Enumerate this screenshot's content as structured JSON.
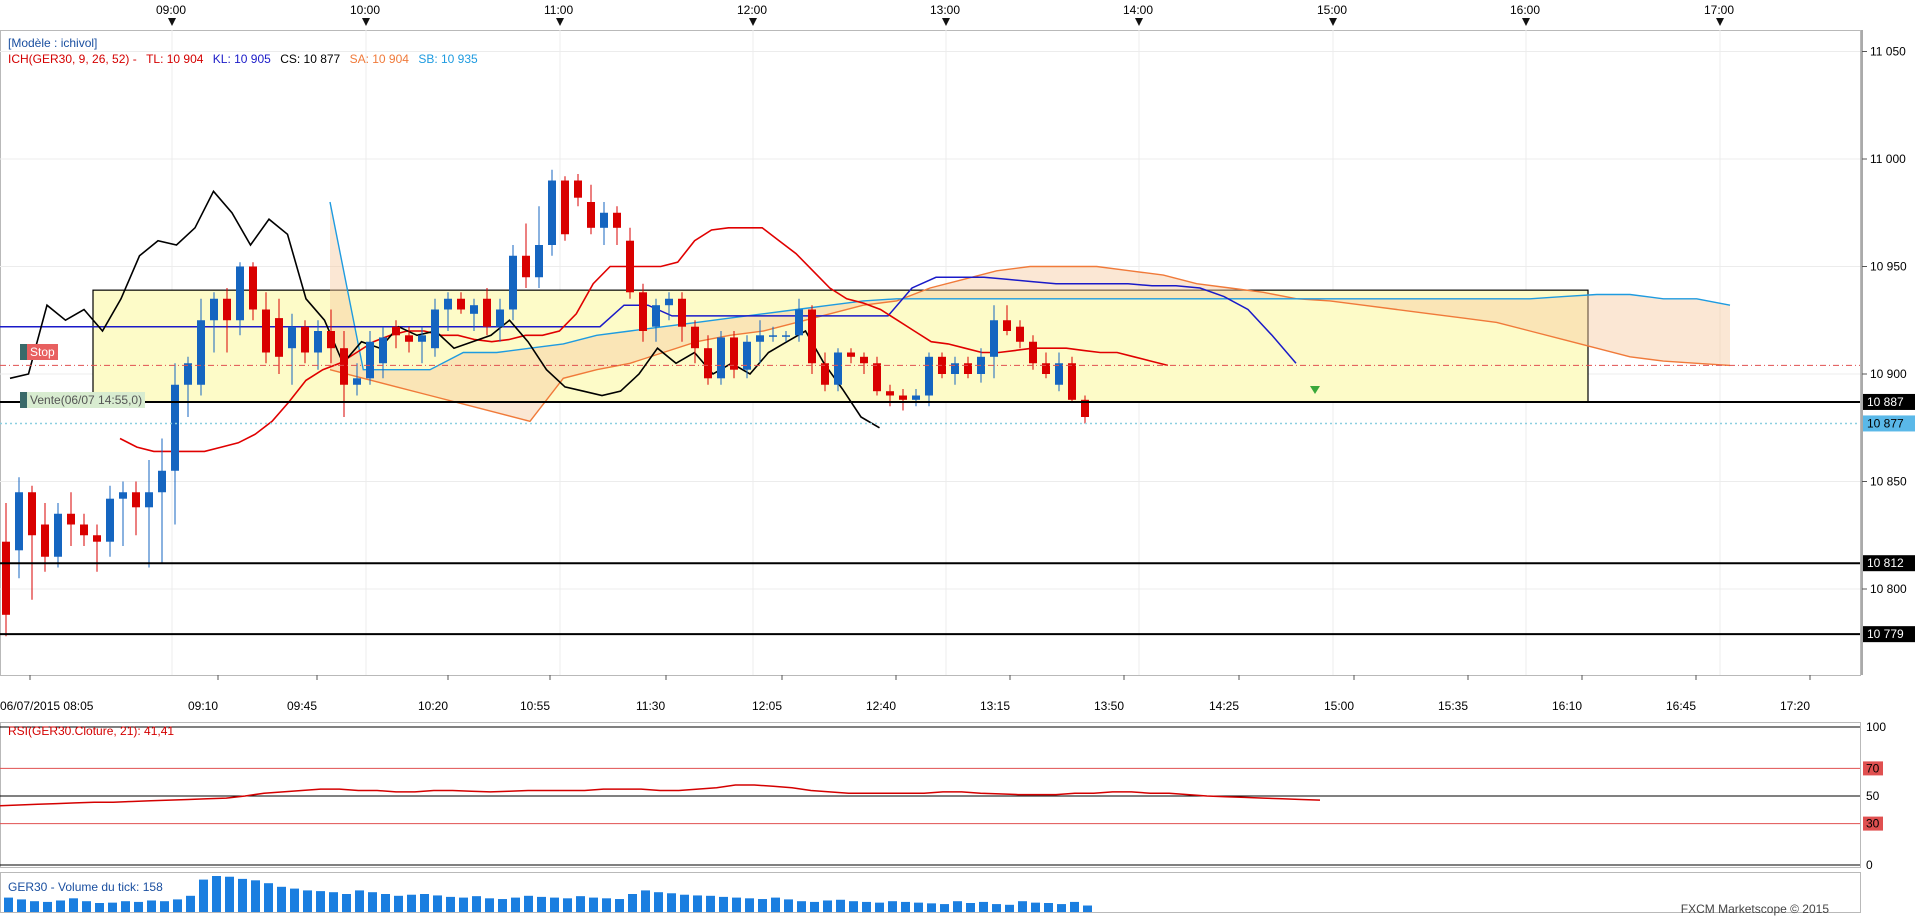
{
  "chart_data": {
    "type": "candlestick",
    "symbol": "GER30",
    "top_time_labels": [
      "09:00",
      "10:00",
      "11:00",
      "12:00",
      "13:00",
      "14:00",
      "15:00",
      "16:00",
      "17:00"
    ],
    "bottom_time_labels": [
      "06/07/2015 08:05",
      "09:10",
      "09:45",
      "10:20",
      "10:55",
      "11:30",
      "12:05",
      "12:40",
      "13:15",
      "13:50",
      "14:25",
      "15:00",
      "15:35",
      "16:10",
      "16:45",
      "17:20"
    ],
    "price_ticks": [
      "11 050",
      "11 000",
      "10 950",
      "10 900",
      "10 850",
      "10 800"
    ],
    "ylim": [
      10760,
      11060
    ],
    "model_label": "[Modèle : ichivol]",
    "ichimoku": {
      "label": "ICH(GER30, 9, 26, 52) -",
      "tl": "TL: 10 904",
      "kl": "KL: 10 905",
      "cs": "CS: 10 877",
      "sa": "SA: 10 904",
      "sb": "SB: 10 935"
    },
    "stop_label": "Stop",
    "sell_label": "Vente(06/07 14:55,0)",
    "horizontal_levels": [
      {
        "label": "10 887",
        "value": 10887
      },
      {
        "label": "10 812",
        "value": 10812
      },
      {
        "label": "10 779",
        "value": 10779
      }
    ],
    "current_price": {
      "label": "10 877",
      "value": 10877
    },
    "candles": [
      {
        "o": 10822,
        "h": 10840,
        "l": 10778,
        "c": 10788
      },
      {
        "o": 10818,
        "h": 10852,
        "l": 10805,
        "c": 10845
      },
      {
        "o": 10845,
        "h": 10848,
        "l": 10795,
        "c": 10825
      },
      {
        "o": 10830,
        "h": 10840,
        "l": 10808,
        "c": 10815
      },
      {
        "o": 10815,
        "h": 10840,
        "l": 10810,
        "c": 10835
      },
      {
        "o": 10835,
        "h": 10845,
        "l": 10820,
        "c": 10830
      },
      {
        "o": 10830,
        "h": 10835,
        "l": 10820,
        "c": 10825
      },
      {
        "o": 10825,
        "h": 10830,
        "l": 10808,
        "c": 10822
      },
      {
        "o": 10822,
        "h": 10848,
        "l": 10815,
        "c": 10842
      },
      {
        "o": 10842,
        "h": 10850,
        "l": 10820,
        "c": 10845
      },
      {
        "o": 10845,
        "h": 10850,
        "l": 10825,
        "c": 10838
      },
      {
        "o": 10838,
        "h": 10860,
        "l": 10810,
        "c": 10845
      },
      {
        "o": 10845,
        "h": 10870,
        "l": 10812,
        "c": 10855
      },
      {
        "o": 10855,
        "h": 10905,
        "l": 10830,
        "c": 10895
      },
      {
        "o": 10895,
        "h": 10908,
        "l": 10880,
        "c": 10905
      },
      {
        "o": 10895,
        "h": 10935,
        "l": 10890,
        "c": 10925
      },
      {
        "o": 10925,
        "h": 10938,
        "l": 10910,
        "c": 10935
      },
      {
        "o": 10935,
        "h": 10940,
        "l": 10910,
        "c": 10925
      },
      {
        "o": 10925,
        "h": 10952,
        "l": 10918,
        "c": 10950
      },
      {
        "o": 10950,
        "h": 10952,
        "l": 10925,
        "c": 10930
      },
      {
        "o": 10930,
        "h": 10938,
        "l": 10905,
        "c": 10910
      },
      {
        "o": 10926,
        "h": 10935,
        "l": 10900,
        "c": 10908
      },
      {
        "o": 10912,
        "h": 10928,
        "l": 10895,
        "c": 10922
      },
      {
        "o": 10922,
        "h": 10925,
        "l": 10905,
        "c": 10910
      },
      {
        "o": 10910,
        "h": 10925,
        "l": 10902,
        "c": 10920
      },
      {
        "o": 10920,
        "h": 10930,
        "l": 10905,
        "c": 10912
      },
      {
        "o": 10912,
        "h": 10920,
        "l": 10880,
        "c": 10895
      },
      {
        "o": 10895,
        "h": 10905,
        "l": 10890,
        "c": 10898
      },
      {
        "o": 10898,
        "h": 10920,
        "l": 10895,
        "c": 10915
      },
      {
        "o": 10905,
        "h": 10922,
        "l": 10898,
        "c": 10917
      },
      {
        "o": 10922,
        "h": 10925,
        "l": 10912,
        "c": 10918
      },
      {
        "o": 10918,
        "h": 10922,
        "l": 10910,
        "c": 10915
      },
      {
        "o": 10915,
        "h": 10922,
        "l": 10905,
        "c": 10918
      },
      {
        "o": 10912,
        "h": 10935,
        "l": 10908,
        "c": 10930
      },
      {
        "o": 10930,
        "h": 10938,
        "l": 10920,
        "c": 10935
      },
      {
        "o": 10935,
        "h": 10938,
        "l": 10928,
        "c": 10930
      },
      {
        "o": 10928,
        "h": 10935,
        "l": 10920,
        "c": 10932
      },
      {
        "o": 10935,
        "h": 10940,
        "l": 10918,
        "c": 10922
      },
      {
        "o": 10922,
        "h": 10935,
        "l": 10915,
        "c": 10930
      },
      {
        "o": 10930,
        "h": 10960,
        "l": 10925,
        "c": 10955
      },
      {
        "o": 10955,
        "h": 10970,
        "l": 10940,
        "c": 10945
      },
      {
        "o": 10945,
        "h": 10978,
        "l": 10940,
        "c": 10960
      },
      {
        "o": 10960,
        "h": 10995,
        "l": 10955,
        "c": 10990
      },
      {
        "o": 10990,
        "h": 10992,
        "l": 10962,
        "c": 10965
      },
      {
        "o": 10990,
        "h": 10993,
        "l": 10978,
        "c": 10982
      },
      {
        "o": 10980,
        "h": 10988,
        "l": 10965,
        "c": 10968
      },
      {
        "o": 10968,
        "h": 10980,
        "l": 10960,
        "c": 10975
      },
      {
        "o": 10975,
        "h": 10978,
        "l": 10960,
        "c": 10968
      },
      {
        "o": 10962,
        "h": 10968,
        "l": 10935,
        "c": 10938
      },
      {
        "o": 10938,
        "h": 10942,
        "l": 10915,
        "c": 10920
      },
      {
        "o": 10922,
        "h": 10935,
        "l": 10915,
        "c": 10932
      },
      {
        "o": 10932,
        "h": 10938,
        "l": 10925,
        "c": 10935
      },
      {
        "o": 10935,
        "h": 10938,
        "l": 10915,
        "c": 10922
      },
      {
        "o": 10922,
        "h": 10925,
        "l": 10905,
        "c": 10912
      },
      {
        "o": 10912,
        "h": 10918,
        "l": 10895,
        "c": 10898
      },
      {
        "o": 10898,
        "h": 10920,
        "l": 10895,
        "c": 10917
      },
      {
        "o": 10917,
        "h": 10920,
        "l": 10898,
        "c": 10902
      },
      {
        "o": 10902,
        "h": 10918,
        "l": 10898,
        "c": 10915
      },
      {
        "o": 10915,
        "h": 10925,
        "l": 10905,
        "c": 10918
      },
      {
        "o": 10918,
        "h": 10922,
        "l": 10915,
        "c": 10918
      },
      {
        "o": 10918,
        "h": 10920,
        "l": 10915,
        "c": 10918
      },
      {
        "o": 10918,
        "h": 10935,
        "l": 10915,
        "c": 10930
      },
      {
        "o": 10930,
        "h": 10932,
        "l": 10900,
        "c": 10905
      },
      {
        "o": 10905,
        "h": 10910,
        "l": 10892,
        "c": 10895
      },
      {
        "o": 10895,
        "h": 10912,
        "l": 10892,
        "c": 10910
      },
      {
        "o": 10910,
        "h": 10912,
        "l": 10905,
        "c": 10908
      },
      {
        "o": 10908,
        "h": 10910,
        "l": 10900,
        "c": 10905
      },
      {
        "o": 10905,
        "h": 10908,
        "l": 10890,
        "c": 10892
      },
      {
        "o": 10892,
        "h": 10895,
        "l": 10885,
        "c": 10890
      },
      {
        "o": 10890,
        "h": 10893,
        "l": 10883,
        "c": 10888
      },
      {
        "o": 10888,
        "h": 10893,
        "l": 10885,
        "c": 10890
      },
      {
        "o": 10890,
        "h": 10910,
        "l": 10885,
        "c": 10908
      },
      {
        "o": 10908,
        "h": 10910,
        "l": 10898,
        "c": 10900
      },
      {
        "o": 10900,
        "h": 10908,
        "l": 10895,
        "c": 10905
      },
      {
        "o": 10905,
        "h": 10908,
        "l": 10898,
        "c": 10900
      },
      {
        "o": 10900,
        "h": 10912,
        "l": 10896,
        "c": 10908
      },
      {
        "o": 10908,
        "h": 10932,
        "l": 10898,
        "c": 10925
      },
      {
        "o": 10925,
        "h": 10932,
        "l": 10918,
        "c": 10920
      },
      {
        "o": 10922,
        "h": 10925,
        "l": 10912,
        "c": 10915
      },
      {
        "o": 10915,
        "h": 10918,
        "l": 10902,
        "c": 10905
      },
      {
        "o": 10905,
        "h": 10910,
        "l": 10898,
        "c": 10900
      },
      {
        "o": 10895,
        "h": 10910,
        "l": 10892,
        "c": 10905
      },
      {
        "o": 10905,
        "h": 10908,
        "l": 10887,
        "c": 10888
      },
      {
        "o": 10888,
        "h": 10890,
        "l": 10877,
        "c": 10880
      }
    ],
    "tenkan_line": [
      10870,
      10866,
      10864,
      10864,
      10864,
      10864,
      10866,
      10868,
      10872,
      10878,
      10887,
      10897,
      10902,
      10905,
      10910,
      10915,
      10918,
      10920,
      10920,
      10918,
      10918,
      10916,
      10915,
      10916,
      10918,
      10918,
      10920,
      10928,
      10942,
      10950,
      10950,
      10950,
      10950,
      10952,
      10962,
      10967,
      10968,
      10968,
      10968,
      10962,
      10956,
      10948,
      10940,
      10935,
      10933,
      10930,
      10925,
      10920,
      10915,
      10914,
      10912,
      10910,
      10910,
      10911,
      10912,
      10912,
      10912,
      10911,
      10910,
      10910,
      10908,
      10906,
      10904
    ],
    "kijun_line": [
      10922,
      10922,
      10922,
      10922,
      10922,
      10922,
      10922,
      10922,
      10922,
      10922,
      10922,
      10922,
      10922,
      10922,
      10922,
      10922,
      10922,
      10922,
      10922,
      10922,
      10922,
      10922,
      10922,
      10922,
      10922,
      10922,
      10932,
      10932,
      10927,
      10927,
      10927,
      10927,
      10927,
      10927,
      10927,
      10927,
      10927,
      10927,
      10940,
      10945,
      10945,
      10945,
      10944,
      10943,
      10942,
      10942,
      10942,
      10942,
      10941,
      10941,
      10940,
      10936,
      10930,
      10918,
      10905
    ],
    "chikou_line": [
      10898,
      10900,
      10932,
      10925,
      10930,
      10920,
      10935,
      10955,
      10962,
      10960,
      10968,
      10985,
      10975,
      10960,
      10972,
      10965,
      10935,
      10925,
      10905,
      10915,
      10912,
      10922,
      10918,
      10920,
      10912,
      10915,
      10918,
      10925,
      10915,
      10902,
      10894,
      10892,
      10890,
      10892,
      10900,
      10912,
      10905,
      10910,
      10900,
      10905,
      10900,
      10910,
      10915,
      10920,
      10905,
      10893,
      10880,
      10875
    ],
    "senkou_a": [
      10902,
      10898,
      10894,
      10890,
      10886,
      10882,
      10878,
      10898,
      10902,
      10905,
      10910,
      10915,
      10918,
      10920,
      10924,
      10928,
      10932,
      10934,
      10940,
      10944,
      10948,
      10950,
      10950,
      10950,
      10948,
      10946,
      10942,
      10940,
      10938,
      10935,
      10934,
      10932,
      10930,
      10928,
      10926,
      10924,
      10920,
      10916,
      10912,
      10908,
      10906,
      10905,
      10904
    ],
    "senkou_b": [
      10980,
      10902,
      10902,
      10902,
      10910,
      10910,
      10912,
      10914,
      10918,
      10920,
      10922,
      10924,
      10926,
      10928,
      10930,
      10932,
      10934,
      10935,
      10935,
      10935,
      10935,
      10935,
      10935,
      10935,
      10935,
      10935,
      10935,
      10935,
      10935,
      10935,
      10935,
      10935,
      10935,
      10935,
      10935,
      10935,
      10935,
      10936,
      10937,
      10937,
      10935,
      10935,
      10932
    ],
    "rsi": {
      "label": "RSI(GER30.Cloture, 21): 41,41",
      "levels": [
        "100",
        "70",
        "50",
        "30",
        "0"
      ],
      "values": [
        43,
        43.5,
        44,
        44.5,
        45,
        45.5,
        45.5,
        46,
        46.5,
        47,
        47.5,
        48,
        48.5,
        50,
        52,
        53,
        54,
        55,
        55,
        54,
        54,
        53,
        53,
        54,
        54,
        53.5,
        53,
        53.5,
        54,
        54,
        54,
        54,
        55,
        55,
        55,
        54,
        54,
        55,
        56,
        58,
        58,
        57,
        56,
        54,
        53,
        52,
        52,
        52,
        52,
        52,
        53,
        53,
        52,
        51.5,
        51,
        51,
        51,
        52,
        52,
        53,
        53,
        52,
        52,
        51,
        50,
        49.5,
        49,
        48.5,
        48,
        47.5,
        47
      ]
    },
    "volume": {
      "label": "GER30 - Volume du tick: 158",
      "values": [
        40,
        35,
        30,
        28,
        32,
        38,
        30,
        25,
        26,
        30,
        28,
        32,
        30,
        35,
        45,
        90,
        100,
        98,
        92,
        88,
        80,
        70,
        65,
        60,
        58,
        55,
        50,
        60,
        55,
        50,
        45,
        48,
        50,
        46,
        42,
        40,
        44,
        38,
        36,
        40,
        45,
        42,
        40,
        38,
        44,
        40,
        38,
        36,
        50,
        60,
        55,
        52,
        48,
        46,
        45,
        42,
        40,
        38,
        36,
        40,
        35,
        30,
        28,
        32,
        34,
        30,
        28,
        26,
        30,
        28,
        26,
        24,
        22,
        30,
        25,
        28,
        22,
        20,
        30,
        26,
        25,
        22,
        28,
        18
      ]
    },
    "footer": "FXCM Marketscope © 2015"
  }
}
